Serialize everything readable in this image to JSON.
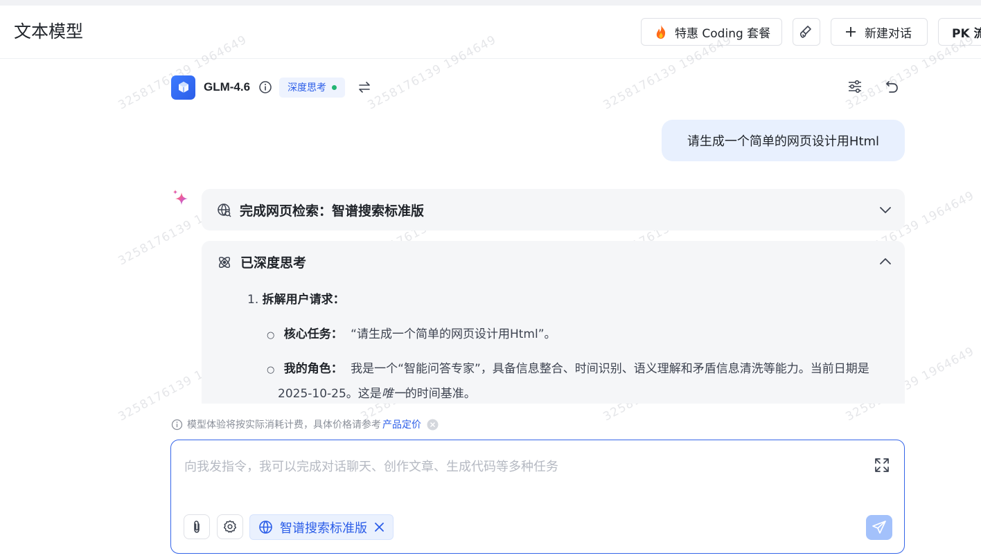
{
  "header": {
    "title": "文本模型",
    "coding_offer_label": "特惠 Coding 套餐",
    "new_chat_label": "新建对话",
    "pk_label": "PK 流"
  },
  "watermark": "3258176139 1964649",
  "model": {
    "name": "GLM-4.6",
    "deep_think_badge": "深度思考"
  },
  "conversation": {
    "user_message": "请生成一个简单的网页设计用Html",
    "search_panel_title": "完成网页检索：智谱搜索标准版",
    "thinking_panel_title": "已深度思考",
    "thinking": {
      "step_number": "1.",
      "step_title": "拆解用户请求：",
      "items": [
        {
          "bullet": "○",
          "label": "核心任务：",
          "text": "“请生成一个简单的网页设计用Html”。"
        },
        {
          "bullet": "○",
          "label": "我的角色：",
          "text_line1": "我是一个“智能问答专家”，具备信息整合、时间识别、语义理解和矛盾信息清洗等能力。当前日期是",
          "text_line2_pre": "2025-10-25。这是",
          "text_line2_em": "唯一",
          "text_line2_post": "的时间基准。"
        }
      ]
    }
  },
  "notice": {
    "text": "模型体验将按实际消耗计费，具体价格请参考",
    "link": "产品定价"
  },
  "input": {
    "placeholder": "向我发指令，我可以完成对话聊天、创作文章、生成代码等多种任务",
    "search_chip_label": "智谱搜索标准版"
  },
  "colors": {
    "accent": "#2b5de8",
    "user_bubble": "#e8f0fe",
    "panel_bg": "#f5f6f8",
    "status_dot": "#22b573",
    "send_disabled": "#a3c1fb"
  }
}
